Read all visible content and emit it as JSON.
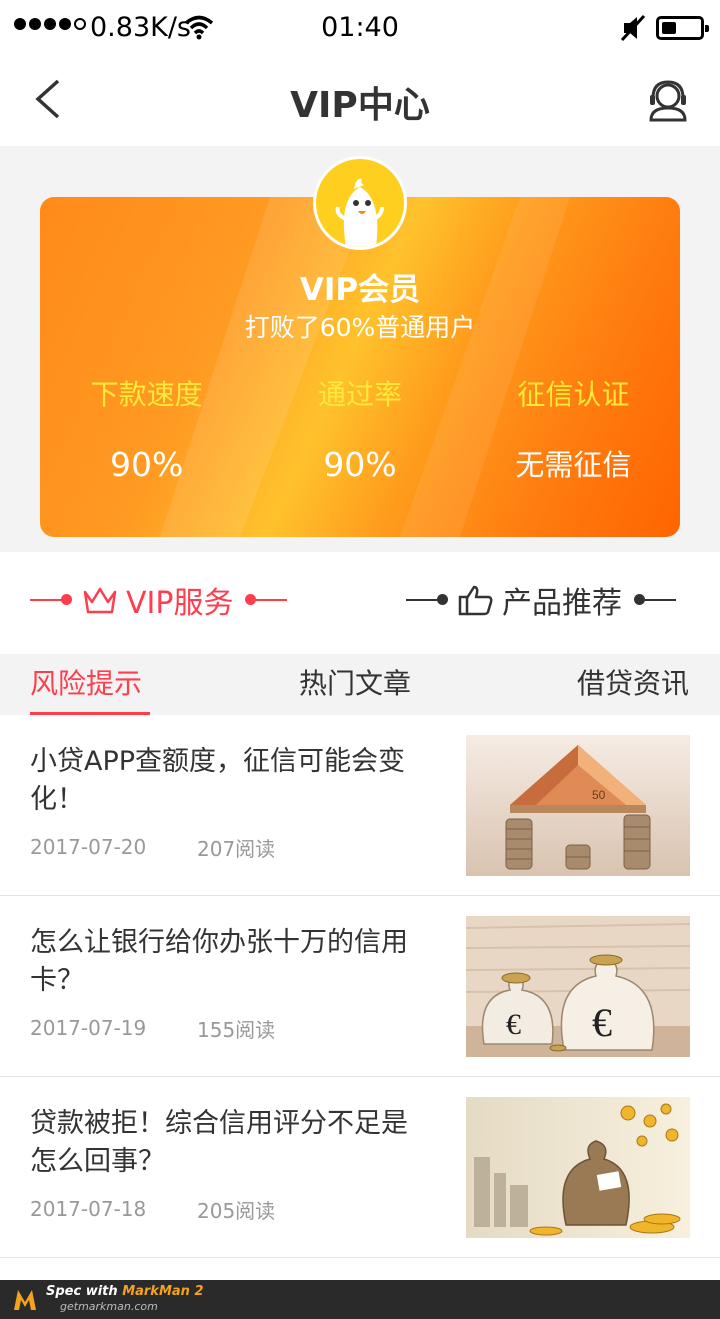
{
  "status_bar": {
    "speed": "0.83K/s",
    "time": "01:40"
  },
  "header": {
    "title": "VIP中心",
    "back_icon": "chevron-left-icon",
    "service_icon": "customer-service-icon"
  },
  "vip_card": {
    "title": "VIP会员",
    "subtitle": "打败了60%普通用户",
    "stats": [
      {
        "label": "下款速度",
        "value": "90%"
      },
      {
        "label": "通过率",
        "value": "90%"
      },
      {
        "label": "征信认证",
        "value": "无需征信"
      }
    ]
  },
  "services": {
    "left": {
      "label": "VIP服务",
      "icon": "crown-icon"
    },
    "right": {
      "label": "产品推荐",
      "icon": "thumbs-up-icon"
    }
  },
  "tabs": [
    {
      "label": "风险提示",
      "active": true
    },
    {
      "label": "热门文章",
      "active": false
    },
    {
      "label": "借贷资讯",
      "active": false
    }
  ],
  "articles": [
    {
      "title": "小贷APP查额度，征信可能会变化！",
      "date": "2017-07-20",
      "reads": "207阅读",
      "image": "money-house-image"
    },
    {
      "title": "怎么让银行给你办张十万的信用卡？",
      "date": "2017-07-19",
      "reads": "155阅读",
      "image": "euro-bags-image"
    },
    {
      "title": "贷款被拒！综合信用评分不足是怎么回事？",
      "date": "2017-07-18",
      "reads": "205阅读",
      "image": "money-bag-coins-image"
    }
  ],
  "footer": {
    "spec_prefix": "Spec with ",
    "brand": "MarkMan 2",
    "url": "getmarkman.com"
  },
  "colors": {
    "accent": "#ff3d4d",
    "gold": "#ffe93a",
    "text": "#333333",
    "muted": "#999999",
    "background": "#f3f3f3"
  }
}
